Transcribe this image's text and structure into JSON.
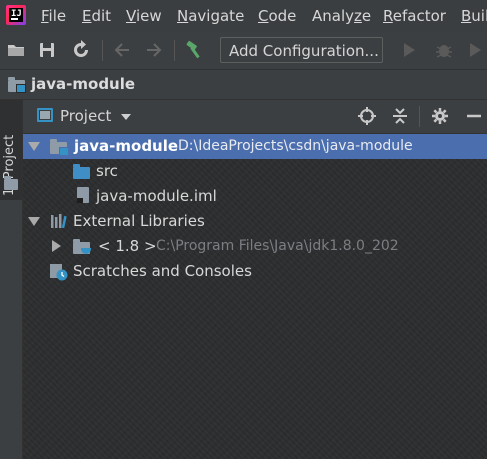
{
  "menu": {
    "items": [
      {
        "label": "File",
        "mnemonic": "F"
      },
      {
        "label": "Edit",
        "mnemonic": "E"
      },
      {
        "label": "View",
        "mnemonic": "V"
      },
      {
        "label": "Navigate",
        "mnemonic": "N"
      },
      {
        "label": "Code",
        "mnemonic": "C"
      },
      {
        "label": "Analyze",
        "mnemonic": "z"
      },
      {
        "label": "Refactor",
        "mnemonic": "R"
      },
      {
        "label": "Buil",
        "mnemonic": "B"
      }
    ]
  },
  "toolbar": {
    "add_configuration": "Add Configuration..."
  },
  "navbar": {
    "project_name": "java-module"
  },
  "tool_strip": {
    "project_tab": "1: Project"
  },
  "project_panel": {
    "title": "Project"
  },
  "tree": {
    "root": {
      "name": "java-module",
      "path": "D:\\IdeaProjects\\csdn\\java-module"
    },
    "src": "src",
    "iml": "java-module.iml",
    "external_libraries": "External Libraries",
    "jdk": {
      "name": "< 1.8 >",
      "path": "C:\\Program Files\\Java\\jdk1.8.0_202"
    },
    "scratches": "Scratches and Consoles"
  },
  "colors": {
    "selection": "#4b6eaf",
    "background": "#2b2b2b",
    "folder_blue": "#3f8ec6",
    "build_hammer": "#59a869"
  },
  "icons": [
    "app-logo",
    "open-folder-icon",
    "save-icon",
    "sync-icon",
    "back-arrow-icon",
    "forward-arrow-icon",
    "build-hammer-icon",
    "run-icon",
    "debug-icon",
    "project-panel-icon",
    "locate-icon",
    "collapse-icon",
    "gear-icon",
    "minimize-icon",
    "module-folder-icon",
    "source-folder-icon",
    "iml-file-icon",
    "libraries-icon",
    "jdk-folder-icon",
    "scratches-icon"
  ]
}
